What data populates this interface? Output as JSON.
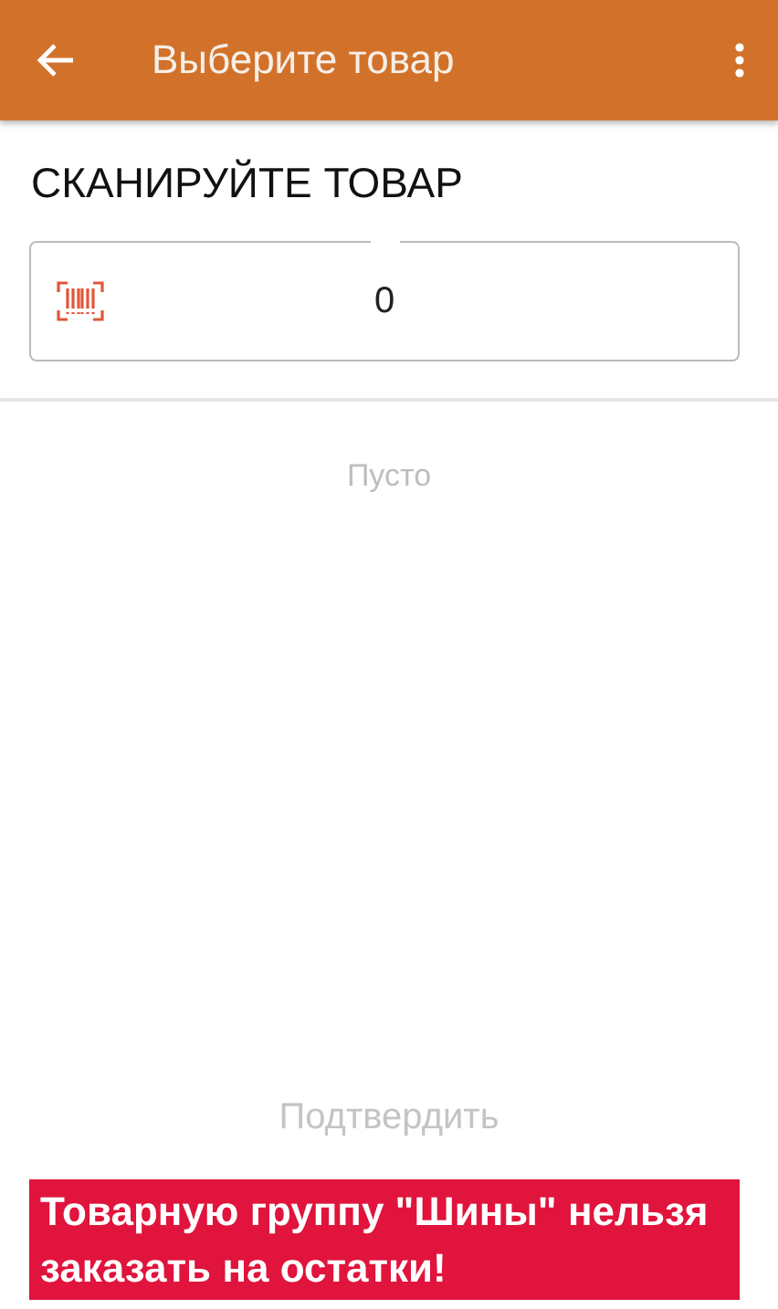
{
  "app_bar": {
    "title": "Выберите товар"
  },
  "heading": "СКАНИРУЙТЕ ТОВАР",
  "scan_field": {
    "value": "0"
  },
  "list": {
    "empty_text": "Пусто"
  },
  "confirm_button": {
    "label": "Подтвердить",
    "disabled": true
  },
  "error_banner": {
    "text": "Товарную группу \"Шины\" нельзя заказать на остатки!"
  }
}
